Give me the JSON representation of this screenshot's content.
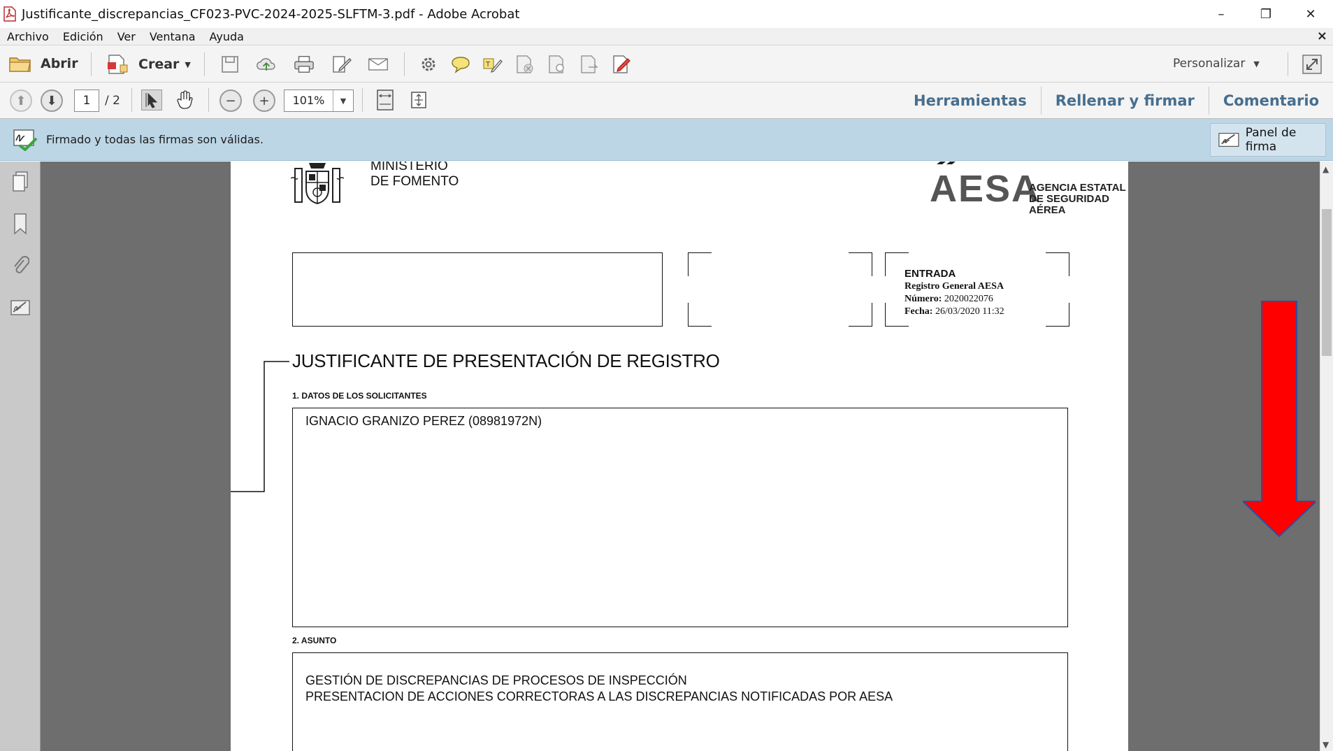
{
  "window": {
    "title": "Justificante_discrepancias_CF023-PVC-2024-2025-SLFTM-3.pdf - Adobe Acrobat",
    "minimize": "–",
    "restore": "❐",
    "close": "✕"
  },
  "menu": {
    "items": [
      "Archivo",
      "Edición",
      "Ver",
      "Ventana",
      "Ayuda"
    ],
    "close_doc": "×"
  },
  "toolbar": {
    "open_label": "Abrir",
    "create_label": "Crear",
    "customize_label": "Personalizar"
  },
  "nav": {
    "current_page": "1",
    "total_pages": "/ 2",
    "zoom": "101%",
    "links": [
      "Herramientas",
      "Rellenar y firmar",
      "Comentario"
    ]
  },
  "signature_bar": {
    "message": "Firmado y todas las firmas son válidas.",
    "panel_button": "Panel de firma"
  },
  "document": {
    "ministry_line1": "MINISTERIO",
    "ministry_line2": "DE FOMENTO",
    "agency_logo": "AESA",
    "agency_line1": "AGENCIA ESTATAL",
    "agency_line2": "DE SEGURIDAD AÉREA",
    "stamp": {
      "heading": "ENTRADA",
      "registry": "Registro General AESA",
      "number_label": "Número:",
      "number_value": "2020022076",
      "date_label": "Fecha:",
      "date_value": "26/03/2020 11:32"
    },
    "title": "JUSTIFICANTE DE PRESENTACIÓN DE REGISTRO",
    "section1_heading": "1. DATOS DE LOS SOLICITANTES",
    "applicant": "IGNACIO GRANIZO PEREZ (08981972N)",
    "section2_heading": "2. ASUNTO",
    "subject_line1": "GESTIÓN DE DISCREPANCIAS DE PROCESOS DE INSPECCIÓN",
    "subject_line2": "PRESENTACION DE ACCIONES CORRECTORAS A LAS DISCREPANCIAS NOTIFICADAS POR AESA"
  },
  "colors": {
    "signature_bar": "#bcd6e6",
    "link_blue": "#476e8e",
    "arrow_red": "#ff0000"
  }
}
